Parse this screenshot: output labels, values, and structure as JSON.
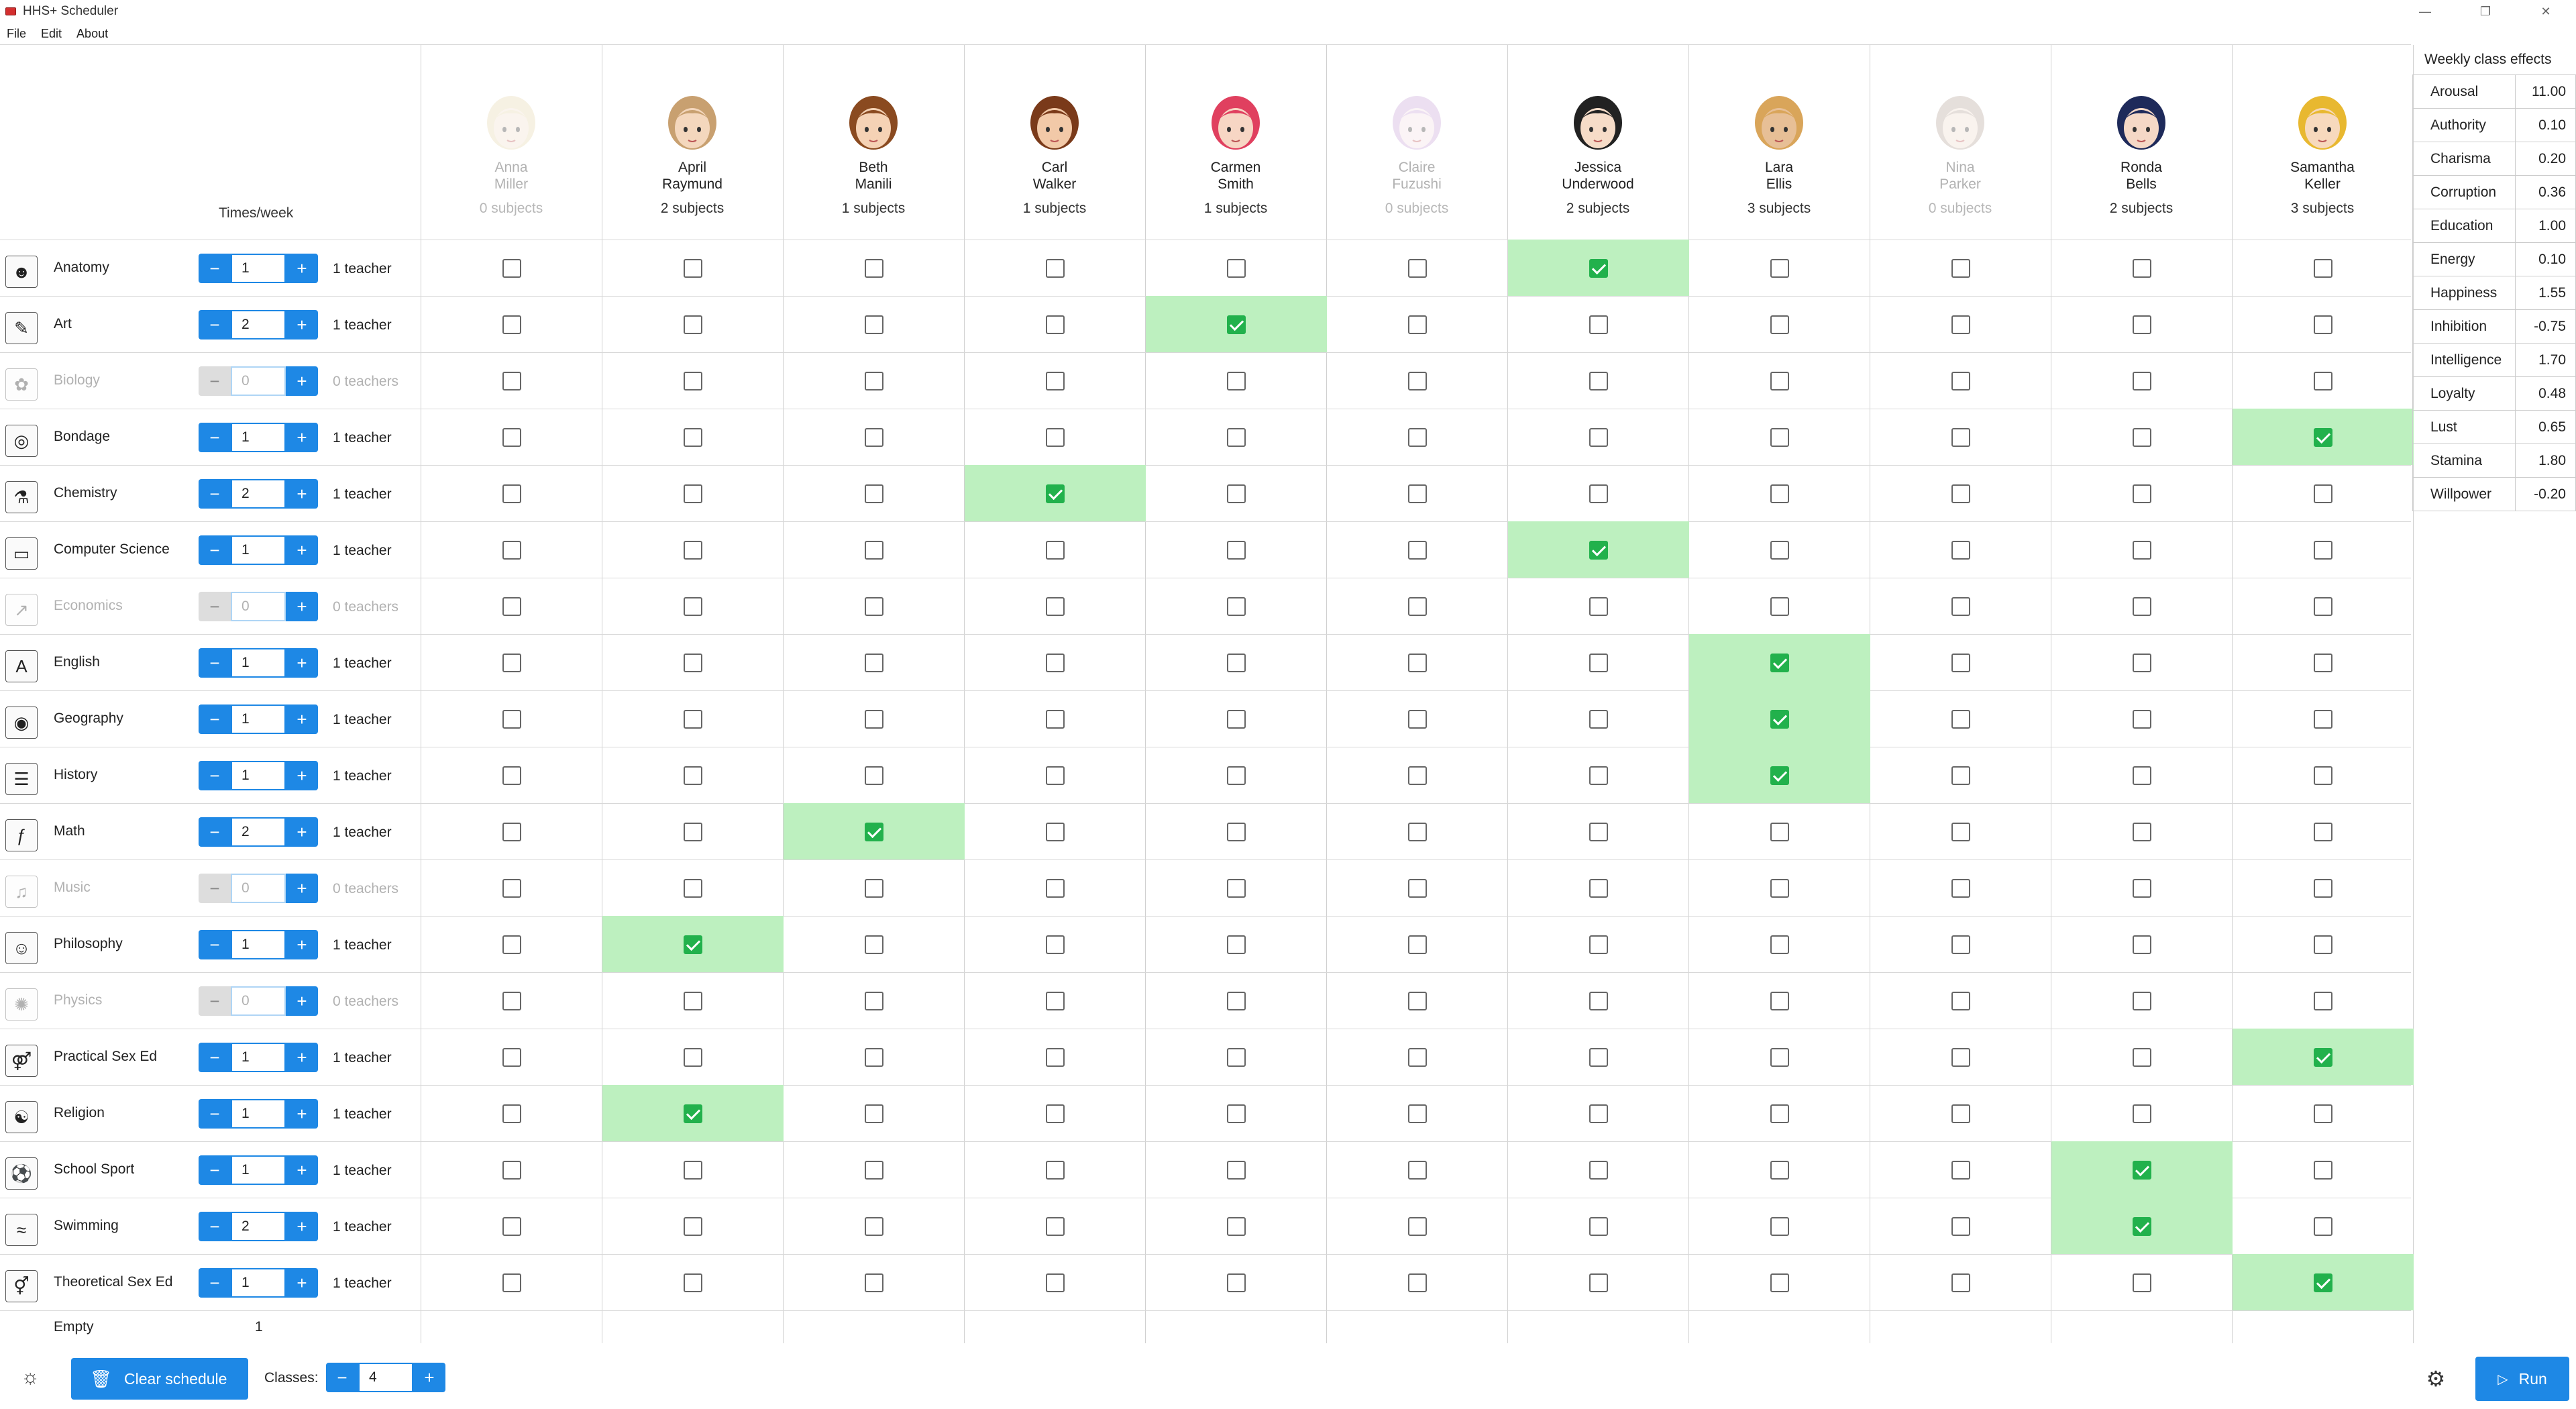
{
  "window": {
    "title": "HHS+ Scheduler"
  },
  "menu": {
    "file": "File",
    "edit": "Edit",
    "about": "About"
  },
  "times_week_label": "Times/week",
  "teachers": [
    {
      "first": "Anna",
      "last": "Miller",
      "count": "0 subjects",
      "dim": true,
      "hair": "#e8d9b0",
      "skin": "#f3e2d0"
    },
    {
      "first": "April",
      "last": "Raymund",
      "count": "2 subjects",
      "dim": false,
      "hair": "#c8a070",
      "skin": "#f4d7bd"
    },
    {
      "first": "Beth",
      "last": "Manili",
      "count": "1 subjects",
      "dim": false,
      "hair": "#8a4a20",
      "skin": "#f5d2b5"
    },
    {
      "first": "Carl",
      "last": "Walker",
      "count": "1 subjects",
      "dim": false,
      "hair": "#7a3a1a",
      "skin": "#f2c9a8"
    },
    {
      "first": "Carmen",
      "last": "Smith",
      "count": "1 subjects",
      "dim": false,
      "hair": "#e0405f",
      "skin": "#f7d6c4"
    },
    {
      "first": "Claire",
      "last": "Fuzushi",
      "count": "0 subjects",
      "dim": true,
      "hair": "#c9a6d9",
      "skin": "#f4e0e6"
    },
    {
      "first": "Jessica",
      "last": "Underwood",
      "count": "2 subjects",
      "dim": false,
      "hair": "#222222",
      "skin": "#f6dcc8"
    },
    {
      "first": "Lara",
      "last": "Ellis",
      "count": "3 subjects",
      "dim": false,
      "hair": "#d9a55a",
      "skin": "#e7bf96"
    },
    {
      "first": "Nina",
      "last": "Parker",
      "count": "0 subjects",
      "dim": true,
      "hair": "#b7a59a",
      "skin": "#f0ddd0"
    },
    {
      "first": "Ronda",
      "last": "Bells",
      "count": "2 subjects",
      "dim": false,
      "hair": "#1e2a5a",
      "skin": "#f5d8c6"
    },
    {
      "first": "Samantha",
      "last": "Keller",
      "count": "3 subjects",
      "dim": false,
      "hair": "#e8b830",
      "skin": "#f7d9bd"
    }
  ],
  "subjects": [
    {
      "name": "Anatomy",
      "icon": "anatomy-icon",
      "glyph": "☻",
      "times": "1",
      "teachers": "1 teacher",
      "enabled": true,
      "assigned": 6
    },
    {
      "name": "Art",
      "icon": "palette-icon",
      "glyph": "✎",
      "times": "2",
      "teachers": "1 teacher",
      "enabled": true,
      "assigned": 4
    },
    {
      "name": "Biology",
      "icon": "flower-icon",
      "glyph": "✿",
      "times": "0",
      "teachers": "0 teachers",
      "enabled": false,
      "assigned": -1
    },
    {
      "name": "Bondage",
      "icon": "rope-icon",
      "glyph": "◎",
      "times": "1",
      "teachers": "1 teacher",
      "enabled": true,
      "assigned": 10
    },
    {
      "name": "Chemistry",
      "icon": "flask-icon",
      "glyph": "⚗",
      "times": "2",
      "teachers": "1 teacher",
      "enabled": true,
      "assigned": 3
    },
    {
      "name": "Computer Science",
      "icon": "monitor-icon",
      "glyph": "▭",
      "times": "1",
      "teachers": "1 teacher",
      "enabled": true,
      "assigned": 6
    },
    {
      "name": "Economics",
      "icon": "chart-icon",
      "glyph": "↗",
      "times": "0",
      "teachers": "0 teachers",
      "enabled": false,
      "assigned": -1
    },
    {
      "name": "English",
      "icon": "chalkboard-icon",
      "glyph": "A",
      "times": "1",
      "teachers": "1 teacher",
      "enabled": true,
      "assigned": 7
    },
    {
      "name": "Geography",
      "icon": "globe-icon",
      "glyph": "◉",
      "times": "1",
      "teachers": "1 teacher",
      "enabled": true,
      "assigned": 7
    },
    {
      "name": "History",
      "icon": "scroll-icon",
      "glyph": "☰",
      "times": "1",
      "teachers": "1 teacher",
      "enabled": true,
      "assigned": 7
    },
    {
      "name": "Math",
      "icon": "function-icon",
      "glyph": "ƒ",
      "times": "2",
      "teachers": "1 teacher",
      "enabled": true,
      "assigned": 2
    },
    {
      "name": "Music",
      "icon": "music-note-icon",
      "glyph": "♫",
      "times": "0",
      "teachers": "0 teachers",
      "enabled": false,
      "assigned": -1
    },
    {
      "name": "Philosophy",
      "icon": "bust-icon",
      "glyph": "☺",
      "times": "1",
      "teachers": "1 teacher",
      "enabled": true,
      "assigned": 1
    },
    {
      "name": "Physics",
      "icon": "atom-icon",
      "glyph": "✺",
      "times": "0",
      "teachers": "0 teachers",
      "enabled": false,
      "assigned": -1
    },
    {
      "name": "Practical Sex Ed",
      "icon": "gender-icon",
      "glyph": "⚤",
      "times": "1",
      "teachers": "1 teacher",
      "enabled": true,
      "assigned": 10
    },
    {
      "name": "Religion",
      "icon": "religion-icon",
      "glyph": "☯",
      "times": "1",
      "teachers": "1 teacher",
      "enabled": true,
      "assigned": 1
    },
    {
      "name": "School Sport",
      "icon": "football-icon",
      "glyph": "⚽",
      "times": "1",
      "teachers": "1 teacher",
      "enabled": true,
      "assigned": 9
    },
    {
      "name": "Swimming",
      "icon": "swimmer-icon",
      "glyph": "≈",
      "times": "2",
      "teachers": "1 teacher",
      "enabled": true,
      "assigned": 9
    },
    {
      "name": "Theoretical Sex Ed",
      "icon": "gender-symbol-icon",
      "glyph": "⚥",
      "times": "1",
      "teachers": "1 teacher",
      "enabled": true,
      "assigned": 10
    }
  ],
  "empty": {
    "label": "Empty",
    "value": "1"
  },
  "effects": {
    "title": "Weekly class effects",
    "rows": [
      {
        "name": "Arousal",
        "value": "11.00"
      },
      {
        "name": "Authority",
        "value": "0.10"
      },
      {
        "name": "Charisma",
        "value": "0.20"
      },
      {
        "name": "Corruption",
        "value": "0.36"
      },
      {
        "name": "Education",
        "value": "1.00"
      },
      {
        "name": "Energy",
        "value": "0.10"
      },
      {
        "name": "Happiness",
        "value": "1.55"
      },
      {
        "name": "Inhibition",
        "value": "-0.75"
      },
      {
        "name": "Intelligence",
        "value": "1.70"
      },
      {
        "name": "Loyalty",
        "value": "0.48"
      },
      {
        "name": "Lust",
        "value": "0.65"
      },
      {
        "name": "Stamina",
        "value": "1.80"
      },
      {
        "name": "Willpower",
        "value": "-0.20"
      }
    ]
  },
  "bottom": {
    "clear_label": "Clear schedule",
    "classes_label": "Classes:",
    "classes_value": "4",
    "run_label": "Run"
  },
  "colors": {
    "accent": "#1e88e5",
    "assigned_bg": "#bdf0bf",
    "check": "#22b14c"
  }
}
